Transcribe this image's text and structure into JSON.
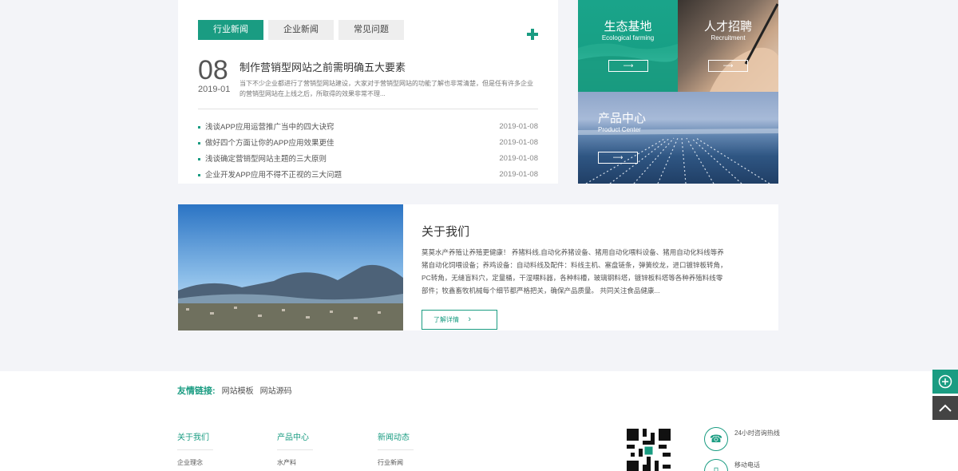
{
  "news": {
    "tabs": [
      "行业新闻",
      "企业新闻",
      "常见问题"
    ],
    "active_tab": 0,
    "feature": {
      "day": "08",
      "year_month": "2019-01",
      "title": "制作营销型网站之前需明确五大要素",
      "summary": "当下不少企业都进行了营销型网站建设，大家对于营销型网站的功能了解也非常清楚，但是任有许多企业的营销型网站在上线之后，所取得的效果非常不理..."
    },
    "items": [
      {
        "title": "浅谈APP应用运营推广当中的四大诀窍",
        "date": "2019-01-08"
      },
      {
        "title": "做好四个方面让你的APP应用效果更佳",
        "date": "2019-01-08"
      },
      {
        "title": "浅谈确定营销型网站主题的三大原则",
        "date": "2019-01-08"
      },
      {
        "title": "企业开发APP应用不得不正视的三大问题",
        "date": "2019-01-08"
      }
    ]
  },
  "tiles": {
    "eco": {
      "title": "生态基地",
      "subtitle": "Ecological farming",
      "arrow": "⟶"
    },
    "talent": {
      "title": "人才招聘",
      "subtitle": "Recruitment",
      "arrow": "⟶"
    },
    "product": {
      "title": "产品中心",
      "subtitle": "Product Center",
      "arrow": "⟶"
    }
  },
  "about": {
    "title": "关于我们",
    "text": "莫莫水产养殖让养殖更健康！ 养猪料线,自动化养猪设备、猪用自动化喂料设备、猪用自动化料线等养猪自动化饲喂设备；养鸡设备：自动料线及配件：料线主机、塞盘链条，弹簧绞龙，进口镀锌板转角，PC转角，无缝盲料穴，定量桶，干湿喂料器，各种料槽，玻璃钢料塔，镀锌板料塔等各种养殖料线零部件；牧鑫畜牧机械每个细节都严格把关，确保产品质量。 共同关注食品健康...",
    "button": "了解详情",
    "button_icon": "›"
  },
  "footer": {
    "friend_label": "友情链接:",
    "friend_links": [
      "网站模板",
      "网站源码"
    ],
    "columns": [
      {
        "heading": "关于我们",
        "item": "企业理念"
      },
      {
        "heading": "产品中心",
        "item": "水产料"
      },
      {
        "heading": "新闻动态",
        "item": "行业新闻"
      }
    ],
    "contacts": [
      {
        "icon": "phone-icon",
        "label": "24小时咨询热线"
      },
      {
        "icon": "mobile-icon",
        "label": "移动电话"
      }
    ]
  },
  "side_tools": {
    "plus": "+",
    "top": "⌃"
  },
  "colors": {
    "accent": "#1a9c82",
    "background": "#f3f4f8"
  }
}
